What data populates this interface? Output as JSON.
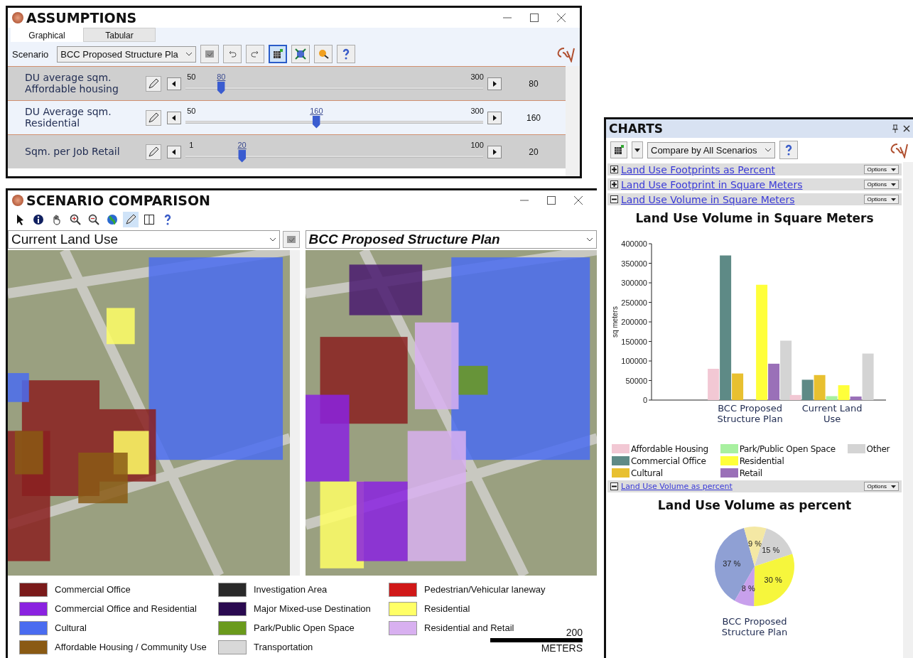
{
  "assumptions": {
    "title": "ASSUMPTIONS",
    "tabs": [
      {
        "label": "Graphical",
        "selected": true
      },
      {
        "label": "Tabular",
        "selected": false
      }
    ],
    "scenario_label": "Scenario",
    "scenario_value": "BCC Proposed Structure Pla",
    "toolbar": [
      {
        "kind": "save",
        "selected": false
      },
      {
        "kind": "undo",
        "selected": false
      },
      {
        "kind": "redo",
        "selected": false
      },
      {
        "kind": "grid",
        "selected": true
      },
      {
        "kind": "extent",
        "selected": false
      },
      {
        "kind": "paint",
        "selected": false
      },
      {
        "kind": "help",
        "selected": false
      }
    ],
    "sliders": [
      {
        "label": "DU average sqm. Affordable housing",
        "min": "50",
        "max": "300",
        "marker": "80",
        "level": 0.12,
        "reading": "80"
      },
      {
        "label": "DU Average sqm. Residential",
        "min": "50",
        "max": "300",
        "marker": "160",
        "level": 0.44,
        "reading": "160"
      },
      {
        "label": "Sqm. per Job Retail",
        "min": "1",
        "max": "100",
        "marker": "20",
        "level": 0.19,
        "reading": "20"
      }
    ]
  },
  "comparison": {
    "title": "SCENARIO COMPARISON",
    "toolbar": [
      {
        "kind": "pointer",
        "selected": false
      },
      {
        "kind": "info",
        "selected": false
      },
      {
        "kind": "pan",
        "selected": false
      },
      {
        "kind": "zoom-in",
        "selected": false
      },
      {
        "kind": "zoom-out",
        "selected": false
      },
      {
        "kind": "globe",
        "selected": false
      },
      {
        "kind": "pen",
        "selected": true
      },
      {
        "kind": "split",
        "selected": false
      },
      {
        "kind": "help",
        "selected": false
      }
    ],
    "left_scenario": "Current Land Use",
    "right_scenario": "BCC Proposed Structure Plan",
    "legend": [
      {
        "label": "Commercial Office",
        "color": "#7a1a1a"
      },
      {
        "label": "Commercial Office and Residential",
        "color": "#8a22e0"
      },
      {
        "label": "Cultural",
        "color": "#4a6cf0"
      },
      {
        "label": "Affordable Housing / Community Use",
        "color": "#8a5a14"
      },
      {
        "label": "Investigation Area",
        "color": "#2a2a2a"
      },
      {
        "label": "Major Mixed-use Destination",
        "color": "#2a0a50"
      },
      {
        "label": "Park/Public Open Space",
        "color": "#6a9a1c"
      },
      {
        "label": "Transportation",
        "color": "#d8d8d8"
      },
      {
        "label": "Pedestrian/Vehicular laneway",
        "color": "#d01818"
      },
      {
        "label": "Residential",
        "color": "#ffff66"
      },
      {
        "label": "Residential and Retail",
        "color": "#d8b0f0"
      }
    ],
    "scale": {
      "value": "200",
      "unit": "METERS"
    }
  },
  "charts": {
    "title": "CHARTS",
    "compare": "Compare by All Scenarios",
    "sections": [
      {
        "title": "Land Use Footprints as Percent",
        "expanded": false,
        "options": "Options"
      },
      {
        "title": "Land Use Footprint in Square Meters",
        "expanded": false,
        "options": "Options"
      },
      {
        "title": "Land Use Volume in Square Meters",
        "expanded": true,
        "options": "Options",
        "chart_data": {
          "type": "bar",
          "title": "Land Use Volume in Square Meters",
          "ylabel": "sq meters",
          "categories": [
            "BCC Proposed Structure Plan",
            "Current Land Use"
          ],
          "legend": "bottom",
          "ylim": [
            0,
            400000
          ],
          "yticks": [
            0,
            50000,
            100000,
            150000,
            200000,
            250000,
            300000,
            350000,
            400000
          ],
          "series": [
            {
              "name": "Affordable Housing",
              "color": "#f2c8d4",
              "values": [
                80000,
                13000
              ]
            },
            {
              "name": "Commercial Office",
              "color": "#5e8a86",
              "values": [
                370000,
                52000
              ]
            },
            {
              "name": "Cultural",
              "color": "#e8c030",
              "values": [
                68000,
                64000
              ]
            },
            {
              "name": "Park/Public Open Space",
              "color": "#a8f0a0",
              "values": [
                null,
                10000
              ]
            },
            {
              "name": "Residential",
              "color": "#ffff3a",
              "values": [
                295000,
                38000
              ]
            },
            {
              "name": "Retail",
              "color": "#9a70b8",
              "values": [
                93000,
                9000
              ]
            },
            {
              "name": "Other",
              "color": "#d4d4d4",
              "values": [
                152000,
                119000
              ]
            }
          ]
        }
      },
      {
        "title": "Land Use Volume as percent",
        "expanded": true,
        "options": "Options",
        "chart_data": {
          "type": "pie",
          "title": "Land Use Volume as percent",
          "xlabel": "BCC Proposed Structure Plan",
          "values": [
            37,
            9,
            15,
            30,
            8
          ],
          "value_labels": [
            "37 %",
            "9 %",
            "15 %",
            "30 %",
            "8 %"
          ],
          "colors": [
            "#8fa0d4",
            "#f4e8a4",
            "#d2d2d2",
            "#f6f63c",
            "#c8a0ec"
          ]
        }
      }
    ]
  }
}
